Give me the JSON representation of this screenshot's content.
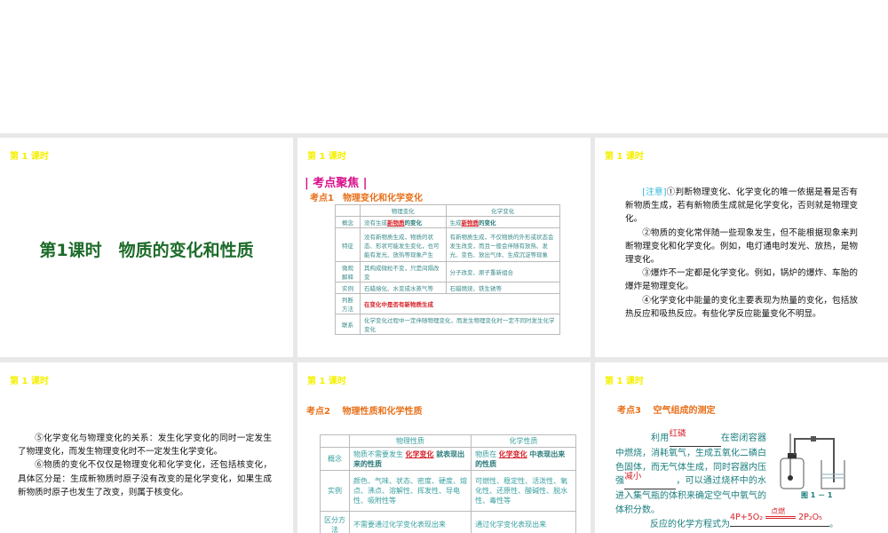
{
  "lesson_tag": "第 1 课时",
  "slide1": {
    "title": "第1课时　物质的变化和性质"
  },
  "slide2": {
    "section": "| 考点聚焦 |",
    "heading": "考点1　物理变化和化学变化",
    "headers": [
      "",
      "物理变化",
      "化学变化"
    ],
    "rows": [
      {
        "label": "概念",
        "phys_pre": "没有生成",
        "phys_ans": "新物质",
        "phys_post": "的变化",
        "chem_pre": "生成",
        "chem_ans": "新物质",
        "chem_post": "的变化"
      },
      {
        "label": "特征",
        "phys": "没有新物质生成，物质的状态、形状可能发生变化，也可能有发光、放热等现象产生",
        "chem": "有新物质生成，不仅物质的外形或状态会发生改变，而且一般会伴随有放热、发光、变色、放出气体、生成沉淀等现象"
      },
      {
        "label": "微观解释",
        "phys": "其构成微粒不变，只是间隔改变",
        "chem": "分子改变、原子重新组合"
      },
      {
        "label": "实例",
        "phys": "石蜡熔化、水变成水蒸气等",
        "chem": "石蜡燃烧、铁生锈等"
      },
      {
        "label": "判断方法",
        "merged": "在变化中是否有新物质生成"
      },
      {
        "label": "联系",
        "merged": "化学变化过程中一定伴随物理变化，而发生物理变化时一定不同时发生化学变化"
      }
    ]
  },
  "slide3": {
    "note": "[注意]",
    "p1": "①判断物理变化、化学变化的唯一依据是看是否有新物质生成，若有新物质生成就是化学变化，否则就是物理变化。",
    "p2": "②物质的变化常伴随一些现象发生，但不能根据现象来判断物理变化和化学变化。例如，电灯通电时发光、放热，是物理变化。",
    "p3": "③爆炸不一定都是化学变化。例如，锅炉的爆炸、车胎的爆炸是物理变化。",
    "p4": "④化学变化中能量的变化主要表现为热量的变化，包括放热反应和吸热反应。有些化学反应能量变化不明显。"
  },
  "slide4": {
    "p5": "⑤化学变化与物理变化的关系：发生化学变化的同时一定发生了物理变化，而发生物理变化时不一定发生化学变化。",
    "p6": "⑥物质的变化不仅仅是物理变化和化学变化，还包括核变化，具体区分是：生成新物质时原子没有改变的是化学变化，如果生成新物质时原子也发生了改变，则属于核变化。"
  },
  "slide5": {
    "heading": "考点2　 物理性质和化学性质",
    "headers": [
      "",
      "物理性质",
      "化学性质"
    ],
    "rows": [
      {
        "label": "概念",
        "phys_pre": "物质不需要发生",
        "phys_ans": "化学变化",
        "phys_post": "就表现出来的性质",
        "chem_pre": "物质在",
        "chem_ans": "化学变化",
        "chem_post": "中表现出来的性质"
      },
      {
        "label": "实例",
        "phys": "颜色、气味、状态、密度、硬度、熔点、沸点、溶解性、挥发性、导电性、吸附性等",
        "chem": "可燃性、稳定性、活泼性、氧化性、还原性、酸碱性、脱水性、毒性等"
      },
      {
        "label": "区分方法",
        "phys": "不需要通过化学变化表现出来",
        "chem": "通过化学变化表现出来"
      }
    ]
  },
  "slide6": {
    "heading": "考点3　 空气组成的测定",
    "t1": "利用",
    "a1": "红磷",
    "t2": "在密闭容器中燃烧，消耗氧气，生成五氧化二磷白色固体，而无气体生成，同时容器内压强",
    "a2": "减小",
    "t3": "，可以通过烧杯中的水进入集气瓶的体积来确定空气中氧气的体积分数。",
    "t4": "反应的化学方程式为",
    "eq_left": "4P+5O₂",
    "eq_cond": "点燃",
    "eq_right": "2P₂O₅",
    "t5": "。",
    "fig": "图 1 － 1"
  }
}
